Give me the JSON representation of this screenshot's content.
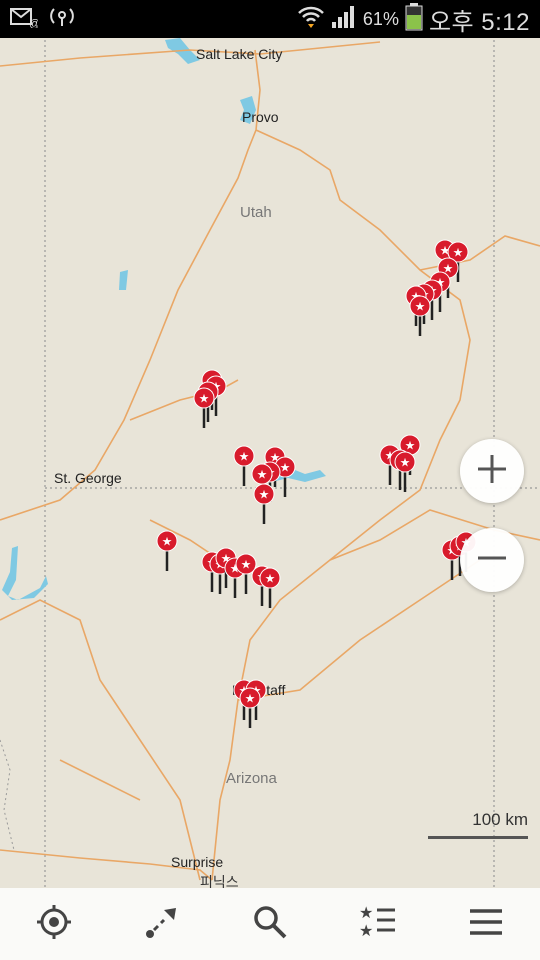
{
  "status_bar": {
    "battery_percent": "61%",
    "clock": "오후 5:12",
    "icons": [
      "email-icon",
      "usb-tethering-icon",
      "wifi-icon",
      "signal-icon",
      "battery-icon"
    ]
  },
  "map": {
    "places": {
      "salt_lake_city": "Salt Lake City",
      "provo": "Provo",
      "st_george": "St. George",
      "flagstaff": "Flagstaff",
      "surprise": "Surprise",
      "phoenix": "피닉스"
    },
    "regions": {
      "utah": "Utah",
      "arizona": "Arizona"
    },
    "marker_icon": "star-pin-icon",
    "marker_color": "#d81b2c",
    "scale_label": "100 km"
  },
  "zoom": {
    "in_icon": "plus-icon",
    "out_icon": "minus-icon"
  },
  "bottom_nav": [
    {
      "name": "my-location",
      "icon": "crosshair-icon"
    },
    {
      "name": "route",
      "icon": "route-icon"
    },
    {
      "name": "search",
      "icon": "search-icon"
    },
    {
      "name": "bookmarks",
      "icon": "bookmarks-list-icon"
    },
    {
      "name": "menu",
      "icon": "hamburger-icon"
    }
  ]
}
